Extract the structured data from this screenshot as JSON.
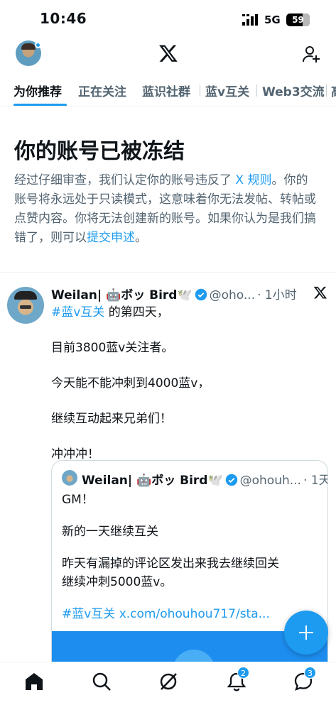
{
  "status_bar": {
    "time": "10:46",
    "network": "5G",
    "battery": "59"
  },
  "tabs": [
    {
      "label": "为你推荐",
      "active": true
    },
    {
      "label": "正在关注"
    },
    {
      "label": "蓝识社群"
    },
    {
      "label": "蓝v互关"
    },
    {
      "label": "Web3交流"
    },
    {
      "label": "高"
    }
  ],
  "notice": {
    "title": "你的账号已被冻结",
    "body_1": "经过仔细审查，我们认定你的账号违反了 ",
    "rules_link": "X 规则",
    "body_2": "。你的账号将永远处于只读模式，这意味着你无法发帖、转帖或点赞内容。你将无法创建新的账号。如果你认为是我们搞错了，则可以",
    "appeal_link": "提交申述",
    "body_3": "。"
  },
  "tweet": {
    "name": "Weilan| 🤖ボッ Bird🕊️",
    "handle": "@oho...",
    "time": "· 1小时",
    "hashtag": "#蓝v互关",
    "line1_rest": " 的第四天，",
    "line2": "目前3800蓝v关注者。",
    "line3": "今天能不能冲刺到4000蓝v，",
    "line4": "继续互动起来兄弟们！",
    "line5": "冲冲冲！"
  },
  "quote": {
    "name": "Weilan| 🤖ボッ Bird🕊️",
    "handle": "@ohouh...",
    "time": "· 1天",
    "line1": "GM！",
    "line2": "新的一天继续互关",
    "line3": "昨天有漏掉的评论区发出来我去继续回关",
    "line4": "继续冲刺5000蓝v。",
    "hashtag": "#蓝v互关",
    "link": " x.com/ohouhou717/sta..."
  },
  "bottom_nav": {
    "notifications_badge": "2",
    "messages_badge": "3"
  },
  "colors": {
    "accent": "#1d9bf0",
    "text_primary": "#0f1419",
    "text_secondary": "#536471"
  }
}
